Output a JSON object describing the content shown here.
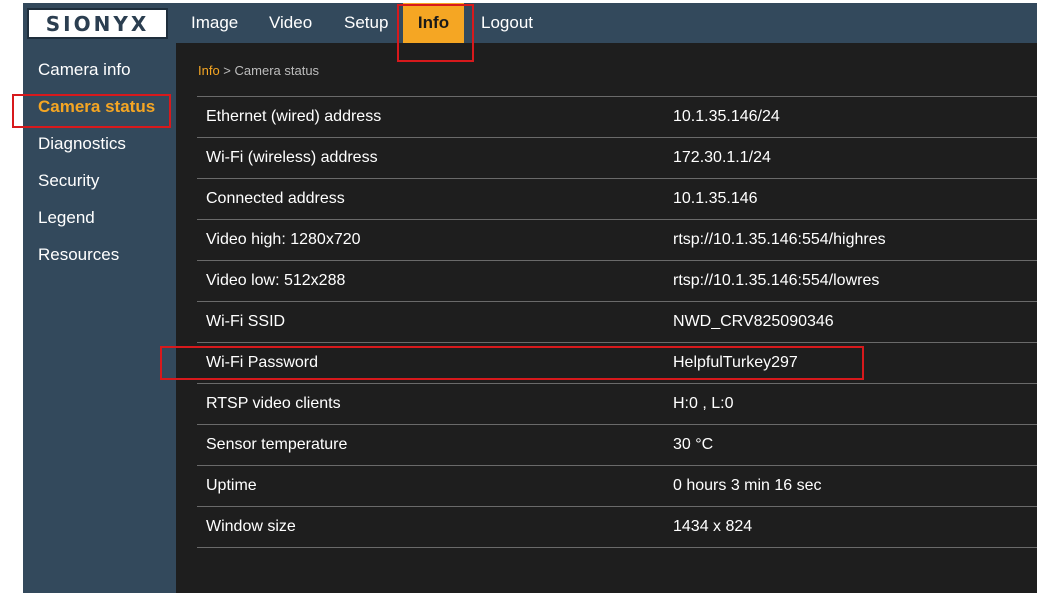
{
  "brand": {
    "logo_text": "SIONYX"
  },
  "topnav": [
    {
      "label": "Image"
    },
    {
      "label": "Video"
    },
    {
      "label": "Setup"
    },
    {
      "label": "Info",
      "active": true
    },
    {
      "label": "Logout"
    }
  ],
  "sidebar": {
    "items": [
      {
        "label": "Camera info"
      },
      {
        "label": "Camera status",
        "active": true
      },
      {
        "label": "Diagnostics"
      },
      {
        "label": "Security"
      },
      {
        "label": "Legend"
      },
      {
        "label": "Resources"
      }
    ]
  },
  "breadcrumb": {
    "parent": "Info",
    "separator": " > ",
    "current": "Camera status"
  },
  "status_table": [
    {
      "key": "Ethernet (wired) address",
      "value": "10.1.35.146/24"
    },
    {
      "key": "Wi-Fi (wireless) address",
      "value": "172.30.1.1/24"
    },
    {
      "key": "Connected address",
      "value": "10.1.35.146"
    },
    {
      "key": "Video high: 1280x720",
      "value": "rtsp://10.1.35.146:554/highres"
    },
    {
      "key": "Video low: 512x288",
      "value": "rtsp://10.1.35.146:554/lowres"
    },
    {
      "key": "Wi-Fi SSID",
      "value": "NWD_CRV825090346"
    },
    {
      "key": "Wi-Fi Password",
      "value": "HelpfulTurkey297"
    },
    {
      "key": "RTSP video clients",
      "value": "H:0 , L:0"
    },
    {
      "key": "Sensor temperature",
      "value": "30 °C"
    },
    {
      "key": "Uptime",
      "value": "0 hours 3 min 16 sec"
    },
    {
      "key": "Window size",
      "value": "1434 x 824"
    }
  ],
  "colors": {
    "nav_bg": "#33495c",
    "accent": "#f5a623",
    "content_bg": "#1e1e1e",
    "highlight_box": "#d7191c"
  }
}
